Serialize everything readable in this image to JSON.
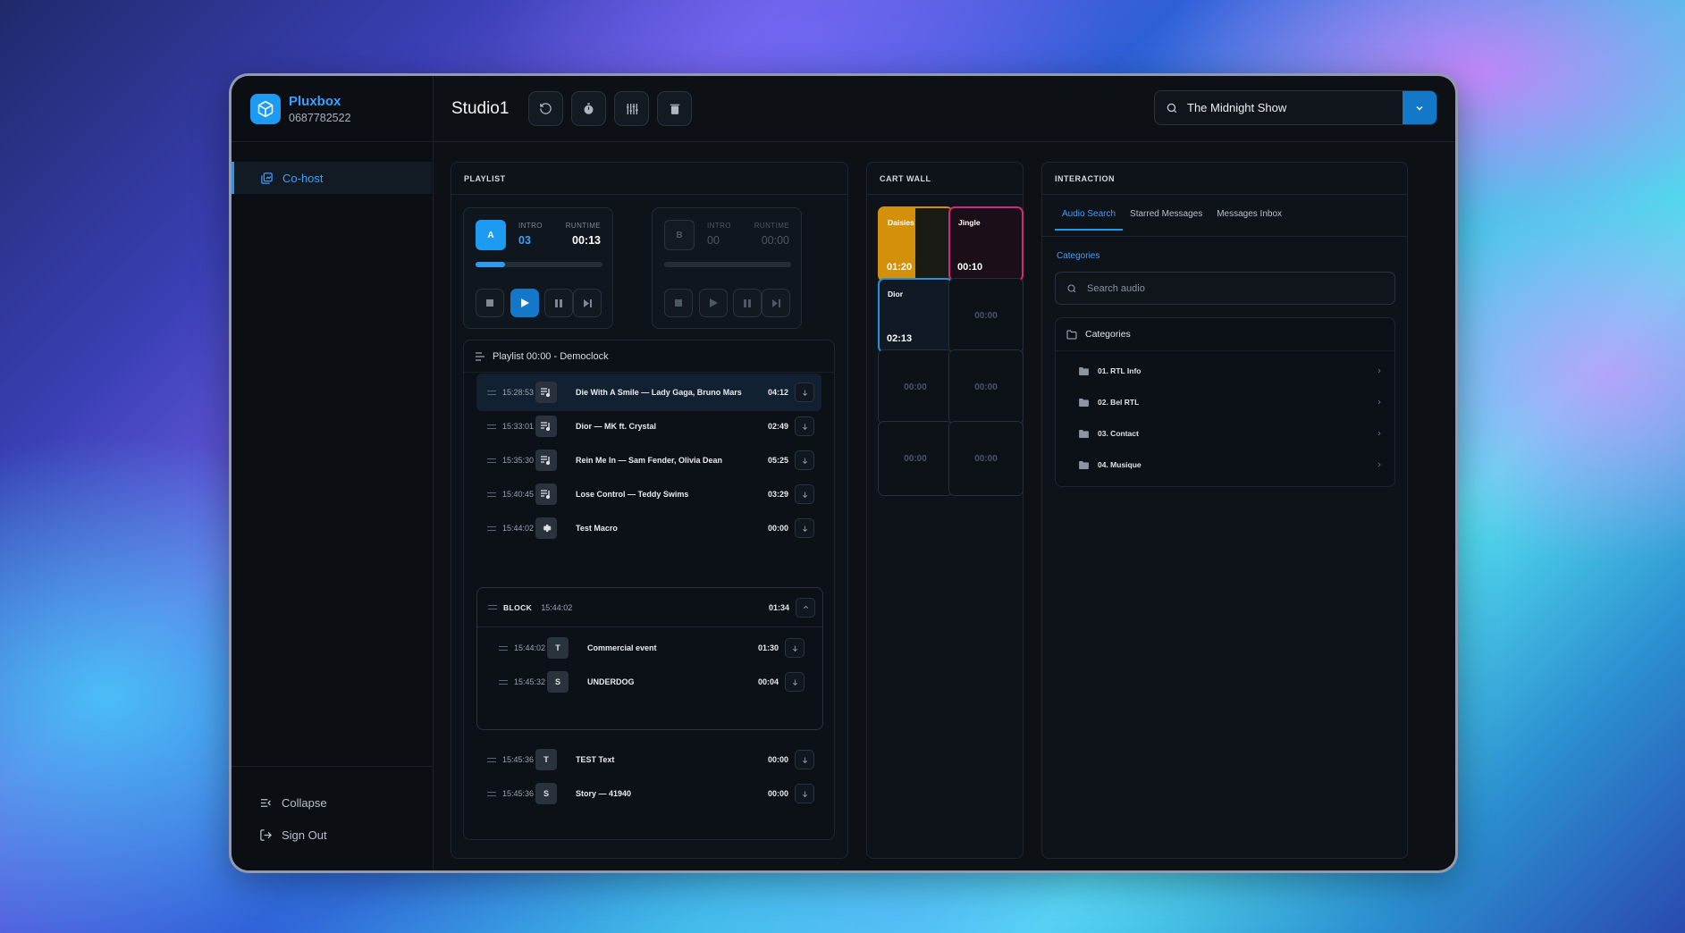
{
  "brand": {
    "name": "Pluxbox",
    "id": "0687782522"
  },
  "sidebar": {
    "items": [
      {
        "label": "Co-host"
      }
    ],
    "collapse_label": "Collapse",
    "signout_label": "Sign Out"
  },
  "topbar": {
    "studio": "Studio1",
    "show": "The Midnight Show"
  },
  "playlist": {
    "header": "PLAYLIST",
    "deck_a": {
      "badge": "A",
      "intro_label": "INTRO",
      "intro": "03",
      "runtime_label": "RUNTIME",
      "runtime": "00:13",
      "progress": 0.23
    },
    "deck_b": {
      "badge": "B",
      "intro_label": "INTRO",
      "intro": "00",
      "runtime_label": "RUNTIME",
      "runtime": "00:00",
      "progress": 0
    },
    "title": "Playlist 00:00 - Democlock",
    "rows": [
      {
        "time": "15:28:53",
        "type": "music-icon",
        "title": "Die With A Smile — Lady Gaga, Bruno Mars",
        "duration": "04:12"
      },
      {
        "time": "15:33:01",
        "type": "music-icon",
        "title": "Dior — MK ft. Crystal",
        "duration": "02:49"
      },
      {
        "time": "15:35:30",
        "type": "music-icon",
        "title": "Rein Me In — Sam Fender, Olivia Dean",
        "duration": "05:25"
      },
      {
        "time": "15:40:45",
        "type": "music-icon",
        "title": "Lose Control — Teddy Swims",
        "duration": "03:29"
      },
      {
        "time": "15:44:02",
        "type": "gear-icon",
        "title": "Test Macro",
        "duration": "00:00"
      }
    ],
    "block": {
      "label": "BLOCK",
      "time": "15:44:02",
      "duration": "01:34",
      "rows": [
        {
          "time": "15:44:02",
          "type": "T",
          "title": "Commercial event",
          "duration": "01:30"
        },
        {
          "time": "15:45:32",
          "type": "S",
          "title": "UNDERDOG",
          "duration": "00:04"
        }
      ]
    },
    "after_rows": [
      {
        "time": "15:45:36",
        "type": "T",
        "title": "TEST Text",
        "duration": "00:00"
      },
      {
        "time": "15:45:36",
        "type": "S",
        "title": "Story — 41940",
        "duration": "00:00"
      }
    ]
  },
  "cartwall": {
    "header": "CART WALL",
    "carts": [
      {
        "name": "Daisies",
        "time": "01:20",
        "color": "#d4900a",
        "progress": 0.5
      },
      {
        "name": "Jingle",
        "time": "00:10",
        "color": "#d0287a"
      },
      {
        "name": "Dior",
        "time": "02:13",
        "color": "#2b8fd6"
      },
      {
        "time": "00:00"
      },
      {
        "time": "00:00"
      },
      {
        "time": "00:00"
      },
      {
        "time": "00:00"
      },
      {
        "time": "00:00"
      }
    ]
  },
  "interaction": {
    "header": "INTERACTION",
    "tabs": [
      "Audio Search",
      "Starred Messages",
      "Messages Inbox"
    ],
    "categories_label": "Categories",
    "search_placeholder": "Search audio",
    "categories_title": "Categories",
    "categories": [
      "01. RTL Info",
      "02. Bel RTL",
      "03. Contact",
      "04. Musique"
    ]
  },
  "colors": {
    "accent": "#1d9bf0",
    "background": "#0d1116"
  }
}
